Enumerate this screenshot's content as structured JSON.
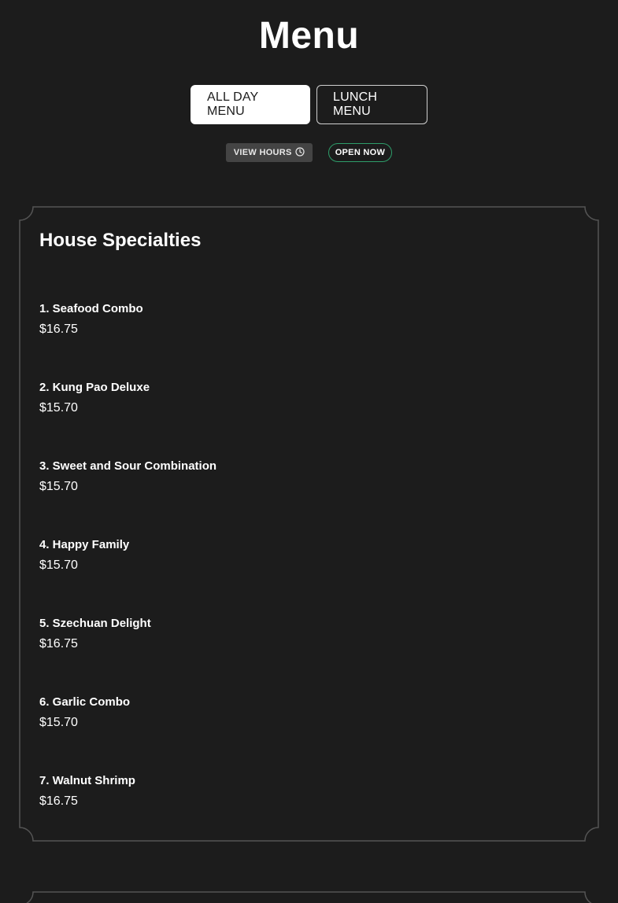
{
  "header": {
    "title": "Menu"
  },
  "tabs": [
    {
      "label": "ALL DAY MENU",
      "active": true
    },
    {
      "label": "LUNCH MENU",
      "active": false
    }
  ],
  "badges": {
    "hours_label": "VIEW HOURS",
    "hours_icon": "clock-icon",
    "status_label": "OPEN NOW"
  },
  "section": {
    "title": "House Specialties",
    "items": [
      {
        "name": "1. Seafood Combo",
        "price": "$16.75"
      },
      {
        "name": "2. Kung Pao Deluxe",
        "price": "$15.70"
      },
      {
        "name": "3. Sweet and Sour Combination",
        "price": "$15.70"
      },
      {
        "name": "4. Happy Family",
        "price": "$15.70"
      },
      {
        "name": "5. Szechuan Delight",
        "price": "$16.75"
      },
      {
        "name": "6. Garlic Combo",
        "price": "$15.70"
      },
      {
        "name": "7. Walnut Shrimp",
        "price": "$16.75"
      }
    ]
  },
  "colors": {
    "background": "#1c1c1c",
    "card_border": "#555555",
    "open_badge_border": "#2e9e6a",
    "hours_badge_bg": "#444444"
  }
}
